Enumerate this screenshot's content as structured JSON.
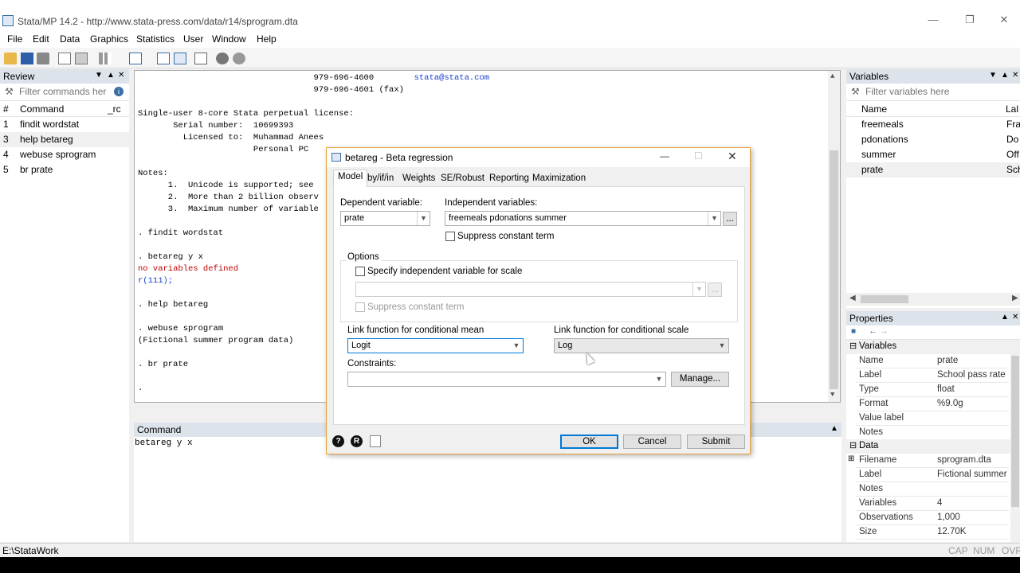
{
  "window": {
    "title": "Stata/MP 14.2 - http://www.stata-press.com/data/r14/sprogram.dta"
  },
  "menu": [
    "File",
    "Edit",
    "Data",
    "Graphics",
    "Statistics",
    "User",
    "Window",
    "Help"
  ],
  "review": {
    "title": "Review",
    "filter_placeholder": "Filter commands here",
    "col_num": "#",
    "col_command": "Command",
    "col_rc": "_rc",
    "rows": [
      {
        "n": "1",
        "cmd": "findit wordstat"
      },
      {
        "n": "3",
        "cmd": "help betareg"
      },
      {
        "n": "4",
        "cmd": "webuse sprogram"
      },
      {
        "n": "5",
        "cmd": "br prate"
      }
    ]
  },
  "results": {
    "lines": [
      {
        "t": "                                   979-696-4600        ",
        "e": "stata@stata.com"
      },
      {
        "t": "                                   979-696-4601 (fax)"
      },
      {
        "t": ""
      },
      {
        "t": "Single-user 8-core Stata perpetual license:"
      },
      {
        "t": "       Serial number:  10699393"
      },
      {
        "t": "         Licensed to:  Muhammad Anees"
      },
      {
        "t": "                       Personal PC"
      },
      {
        "t": ""
      },
      {
        "t": "Notes:"
      },
      {
        "t": "      1.  Unicode is supported; see"
      },
      {
        "t": "      2.  More than 2 billion observ"
      },
      {
        "t": "      3.  Maximum number of variable"
      },
      {
        "t": ""
      },
      {
        "t": ". findit wordstat"
      },
      {
        "t": ""
      },
      {
        "t": ". betareg y x"
      },
      {
        "t": "no variables defined",
        "c": "red"
      },
      {
        "t": "r(111);",
        "c": "blue"
      },
      {
        "t": ""
      },
      {
        "t": ". help betareg"
      },
      {
        "t": ""
      },
      {
        "t": ". webuse sprogram"
      },
      {
        "t": "(Fictional summer program data)"
      },
      {
        "t": ""
      },
      {
        "t": ". br prate"
      },
      {
        "t": ""
      },
      {
        "t": "."
      }
    ]
  },
  "command": {
    "title": "Command",
    "value": "betareg y x"
  },
  "variables": {
    "title": "Variables",
    "filter_placeholder": "Filter variables here",
    "col_name": "Name",
    "col_label": "Lal",
    "rows": [
      {
        "name": "freemeals",
        "label": "Fra"
      },
      {
        "name": "pdonations",
        "label": "Do"
      },
      {
        "name": "summer",
        "label": "Off"
      },
      {
        "name": "prate",
        "label": "Sch"
      }
    ]
  },
  "properties": {
    "title": "Properties",
    "section_variables": "Variables",
    "variables": [
      {
        "k": "Name",
        "v": "prate"
      },
      {
        "k": "Label",
        "v": "School pass rate"
      },
      {
        "k": "Type",
        "v": "float"
      },
      {
        "k": "Format",
        "v": "%9.0g"
      },
      {
        "k": "Value label",
        "v": ""
      },
      {
        "k": "Notes",
        "v": ""
      }
    ],
    "section_data": "Data",
    "data": [
      {
        "k": "Filename",
        "v": "sprogram.dta"
      },
      {
        "k": "Label",
        "v": "Fictional summer"
      },
      {
        "k": "Notes",
        "v": ""
      },
      {
        "k": "Variables",
        "v": "4"
      },
      {
        "k": "Observations",
        "v": "1,000"
      },
      {
        "k": "Size",
        "v": "12.70K"
      }
    ]
  },
  "dialog": {
    "title": "betareg - Beta regression",
    "tabs": [
      "Model",
      "by/if/in",
      "Weights",
      "SE/Robust",
      "Reporting",
      "Maximization"
    ],
    "dep_label": "Dependent variable:",
    "dep_value": "prate",
    "indep_label": "Independent variables:",
    "indep_value": "freemeals pdonations summer",
    "suppress_const": "Suppress constant term",
    "options_label": "Options",
    "specify_scale": "Specify independent variable for scale",
    "suppress_const_scale": "Suppress constant term",
    "link_mean_label": "Link function for conditional mean",
    "link_mean_value": "Logit",
    "link_scale_label": "Link function for conditional scale",
    "link_scale_value": "Log",
    "constraints_label": "Constraints:",
    "manage": "Manage...",
    "ok": "OK",
    "cancel": "Cancel",
    "submit": "Submit",
    "ellipsis": "..."
  },
  "status": {
    "path": "E:\\StataWork",
    "cap": "CAP",
    "num": "NUM",
    "ovr": "OVR"
  }
}
